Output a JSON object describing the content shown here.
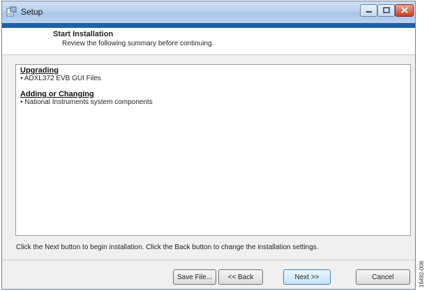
{
  "window": {
    "title": "Setup"
  },
  "header": {
    "title": "Start Installation",
    "subtitle": "Review the following summary before continuing."
  },
  "summary": {
    "sections": [
      {
        "heading": "Upgrading",
        "items": [
          "• ADXL372 EVB GUI Files"
        ]
      },
      {
        "heading": "Adding or Changing",
        "items": [
          "• National Instruments system components"
        ]
      }
    ]
  },
  "instruction": "Click the Next button to begin installation.  Click the Back button to change the installation settings.",
  "buttons": {
    "save": "Save File...",
    "back": "<< Back",
    "next": "Next >>",
    "cancel": "Cancel"
  },
  "figure_id": "16492-008",
  "colors": {
    "accent_bar": "#1f61a5",
    "titlebar": "#b9d1ee",
    "close_button": "#c8421f"
  },
  "icons": {
    "app": "setup-icon",
    "minimize": "minimize-icon",
    "maximize": "maximize-icon",
    "close": "close-icon"
  }
}
